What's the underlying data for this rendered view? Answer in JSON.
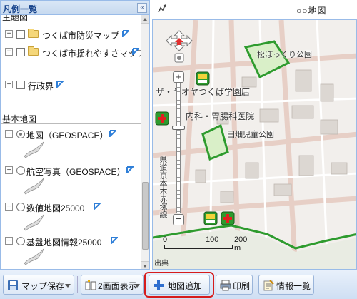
{
  "legend": {
    "title": "凡例一覧",
    "collapse_glyph": "«",
    "sections": {
      "thematic": "主題図",
      "base": "基本地図"
    },
    "thematic_layers": [
      {
        "label": "つくば市防災マップ",
        "icon": "folder-icon",
        "checked": false,
        "expanded": false
      },
      {
        "label": "つくば市揺れやすさマップ",
        "icon": "folder-icon",
        "checked": false,
        "expanded": false
      },
      {
        "label": "行政界",
        "icon": "checkbox",
        "checked": false,
        "expanded": true
      }
    ],
    "base_layers": [
      {
        "label": "地図（GEOSPACE）",
        "selected": true
      },
      {
        "label": "航空写真（GEOSPACE）",
        "selected": false
      },
      {
        "label": "数値地図25000",
        "selected": false
      },
      {
        "label": "基盤地図情報25000",
        "selected": false
      }
    ]
  },
  "map": {
    "title": "○○地図",
    "labels": {
      "park1": "松ぼっくり公園",
      "store": "ザ・ヤオヤつくば学園店",
      "clinic": "内科・胃腸科医院",
      "nursery": "田畑児童公園",
      "road": "県道京本木赤塚線"
    },
    "scale": {
      "zero": "0",
      "mid": "100",
      "end": "200 m"
    },
    "attribution": "出典"
  },
  "toolbar": {
    "save_map": "マップ保存",
    "split_view": "2画面表示",
    "add_map": "地図追加",
    "print": "印刷",
    "info_list": "情報一覧"
  },
  "colors": {
    "accent_blue": "#15428b",
    "highlight_red": "#d61c1c",
    "park_green": "#2e9b2e",
    "road_pink": "#e7cfc6"
  }
}
